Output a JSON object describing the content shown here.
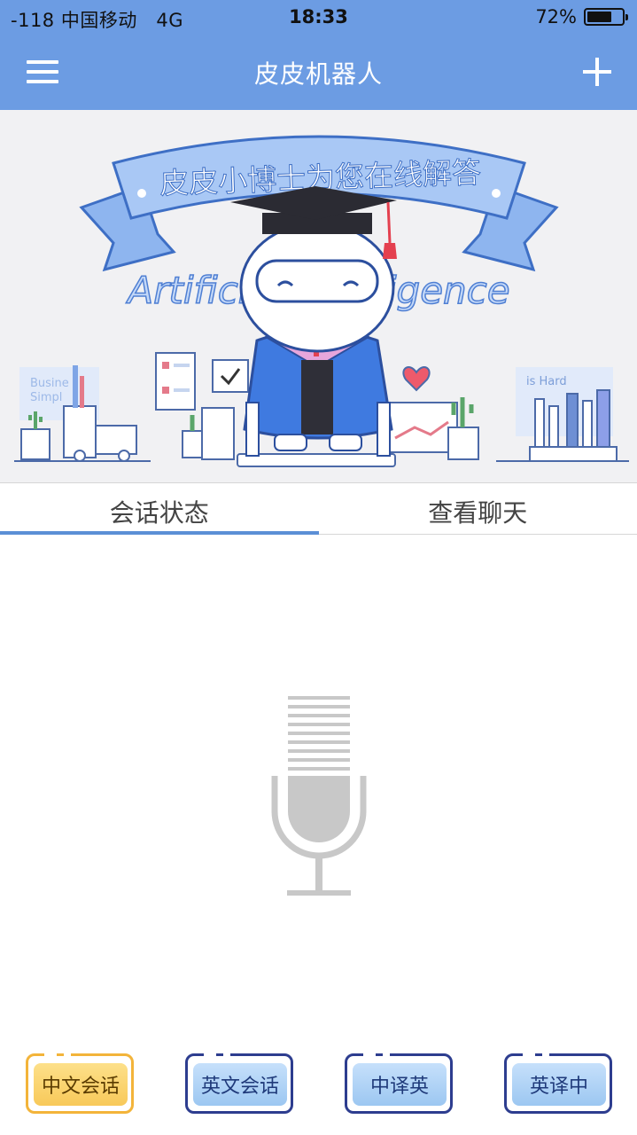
{
  "status_bar": {
    "carrier": "-118 中国移动",
    "network": "4G",
    "time": "18:33",
    "battery_percent": "72%",
    "battery_level": 0.72
  },
  "nav": {
    "title": "皮皮机器人"
  },
  "banner": {
    "ribbon_text": "皮皮小博士为您在线解答",
    "ai_text": "Artificial Intelligence",
    "bg_text_left_1": "Busine",
    "bg_text_left_2": "Simpl",
    "bg_text_right": "is Hard"
  },
  "tabs": [
    {
      "label": "会话状态",
      "active": true
    },
    {
      "label": "查看聊天",
      "active": false
    }
  ],
  "modes": [
    {
      "label": "中文会话",
      "active": true
    },
    {
      "label": "英文会话",
      "active": false
    },
    {
      "label": "中译英",
      "active": false
    },
    {
      "label": "英译中",
      "active": false
    }
  ],
  "colors": {
    "primary": "#6c9ce3",
    "tab_indicator": "#5b8fd6",
    "active_mode": "#f8c95a",
    "inactive_mode": "#9cc7f1",
    "mode_border": "#2d3d8f"
  }
}
